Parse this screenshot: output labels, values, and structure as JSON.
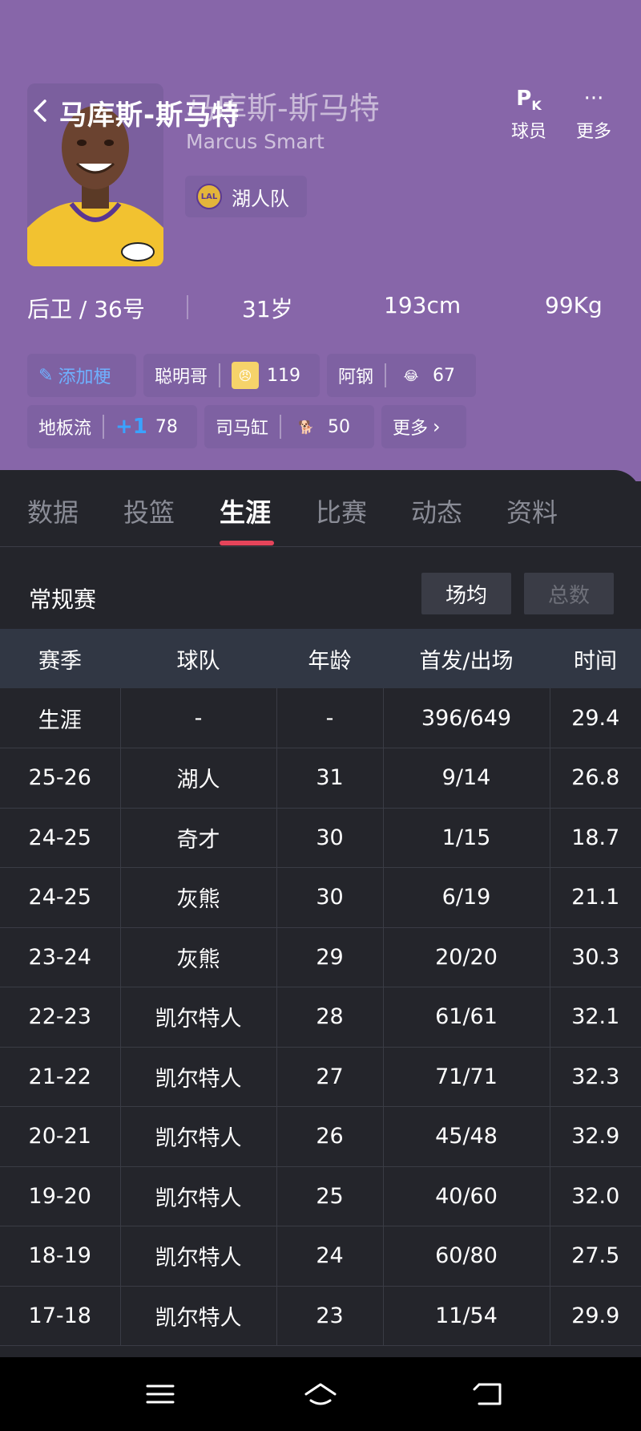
{
  "header": {
    "title": "马库斯-斯马特",
    "name_cn": "马库斯-斯马特",
    "name_en": "Marcus Smart",
    "team": "湖人队",
    "team_logo_text": "LAL",
    "actions": [
      {
        "icon": "pk-icon",
        "label": "球员"
      },
      {
        "icon": "more-icon",
        "label": "更多"
      }
    ],
    "info": {
      "position_number": "后卫 / 36号",
      "age": "31岁",
      "height": "193cm",
      "weight": "99Kg"
    }
  },
  "tags": {
    "add": "添加梗",
    "items": [
      {
        "label": "聪明哥",
        "count": "119"
      },
      {
        "label": "阿钢",
        "count": "67"
      },
      {
        "label": "地板流",
        "count": "78",
        "badge": "+1"
      },
      {
        "label": "司马缸",
        "count": "50"
      }
    ],
    "more": "更多"
  },
  "tabs": [
    "数据",
    "投篮",
    "生涯",
    "比赛",
    "动态",
    "资料"
  ],
  "active_tab": "生涯",
  "section": {
    "title": "常规赛",
    "toggle": [
      "场均",
      "总数"
    ],
    "toggle_active": "场均"
  },
  "table": {
    "headers": [
      "赛季",
      "球队",
      "年龄",
      "首发/出场",
      "时间"
    ],
    "rows": [
      [
        "生涯",
        "-",
        "-",
        "396/649",
        "29.4"
      ],
      [
        "25-26",
        "湖人",
        "31",
        "9/14",
        "26.8"
      ],
      [
        "24-25",
        "奇才",
        "30",
        "1/15",
        "18.7"
      ],
      [
        "24-25",
        "灰熊",
        "30",
        "6/19",
        "21.1"
      ],
      [
        "23-24",
        "灰熊",
        "29",
        "20/20",
        "30.3"
      ],
      [
        "22-23",
        "凯尔特人",
        "28",
        "61/61",
        "32.1"
      ],
      [
        "21-22",
        "凯尔特人",
        "27",
        "71/71",
        "32.3"
      ],
      [
        "20-21",
        "凯尔特人",
        "26",
        "45/48",
        "32.9"
      ],
      [
        "19-20",
        "凯尔特人",
        "25",
        "40/60",
        "32.0"
      ],
      [
        "18-19",
        "凯尔特人",
        "24",
        "60/80",
        "27.5"
      ],
      [
        "17-18",
        "凯尔特人",
        "23",
        "11/54",
        "29.9"
      ]
    ]
  },
  "colors": {
    "header_bg": "#8766a9",
    "page_bg": "#24252b",
    "accent": "#e5445a",
    "link_blue": "#6fb1ff"
  }
}
